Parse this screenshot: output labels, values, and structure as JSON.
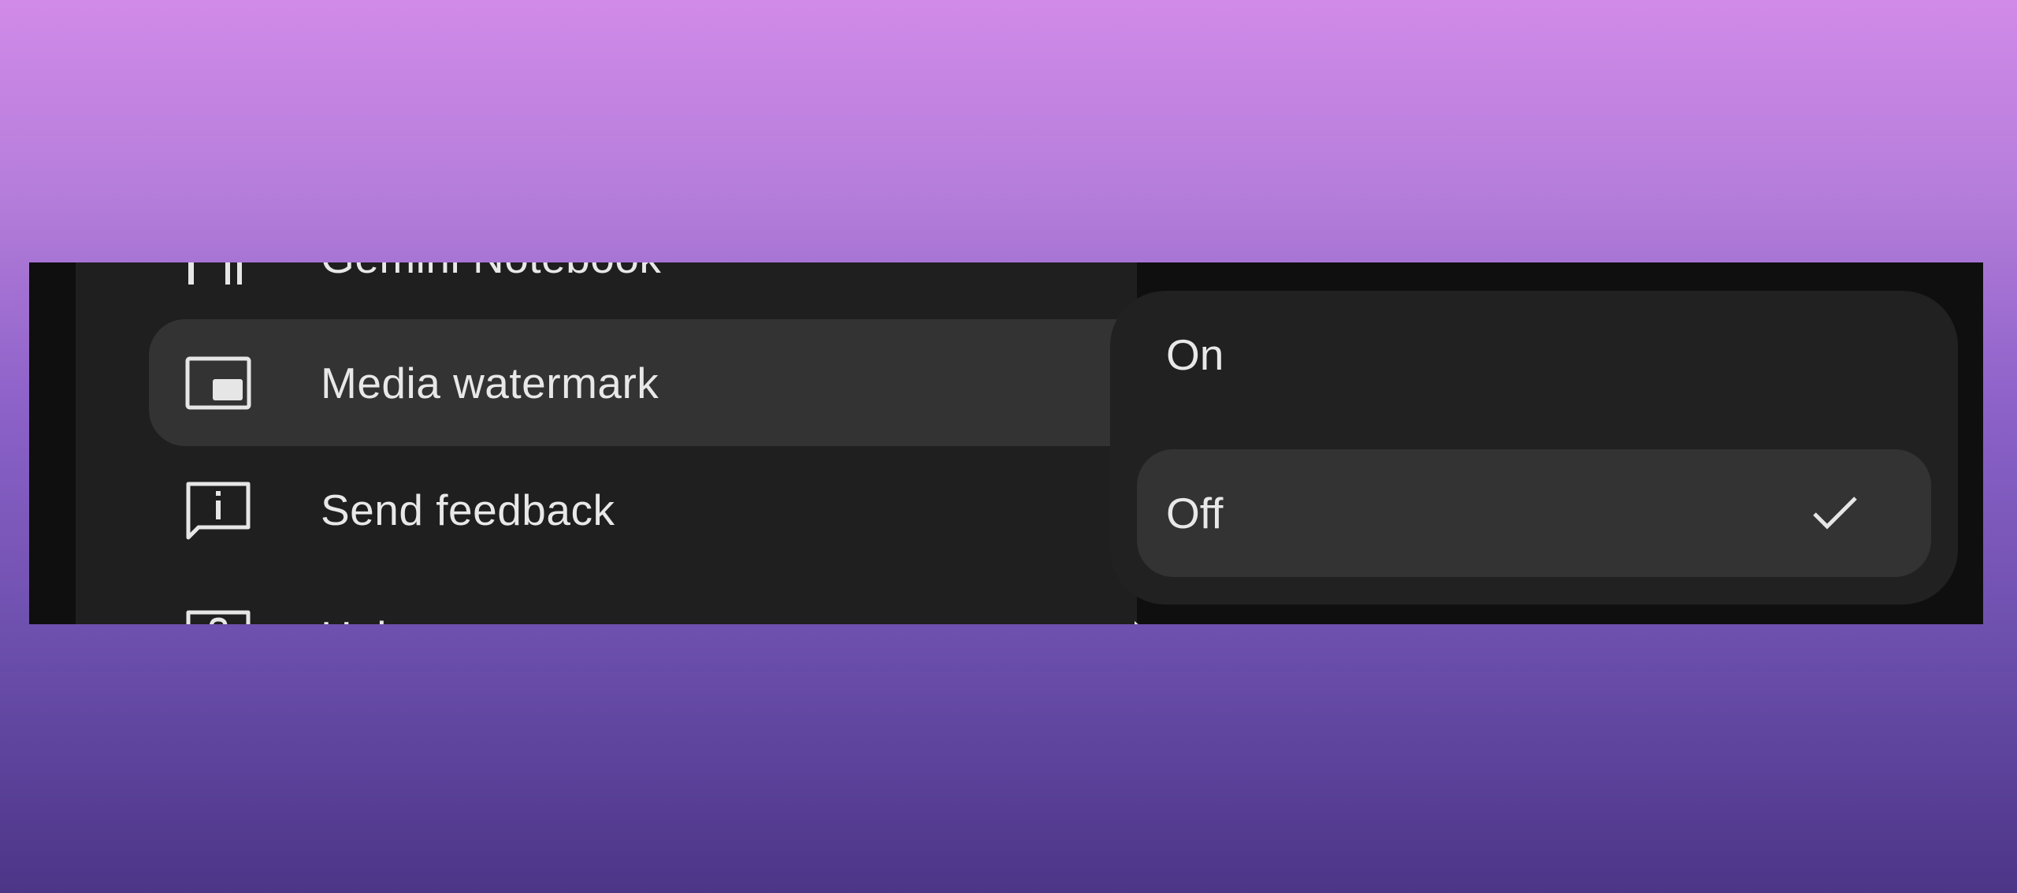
{
  "menu": {
    "items": [
      {
        "label": "Gemini Notebook",
        "icon": "notebook-icon"
      },
      {
        "label": "Media watermark",
        "icon": "picture-in-picture-icon",
        "has_submenu": true
      },
      {
        "label": "Send feedback",
        "icon": "feedback-icon"
      },
      {
        "label": "Help",
        "icon": "help-icon",
        "has_submenu": true
      }
    ]
  },
  "submenu": {
    "options": [
      {
        "label": "On",
        "selected": false
      },
      {
        "label": "Off",
        "selected": true
      }
    ]
  },
  "colors": {
    "menu_background": "#1f1f1f",
    "highlight": "#333333",
    "text": "#e8e8e8"
  }
}
